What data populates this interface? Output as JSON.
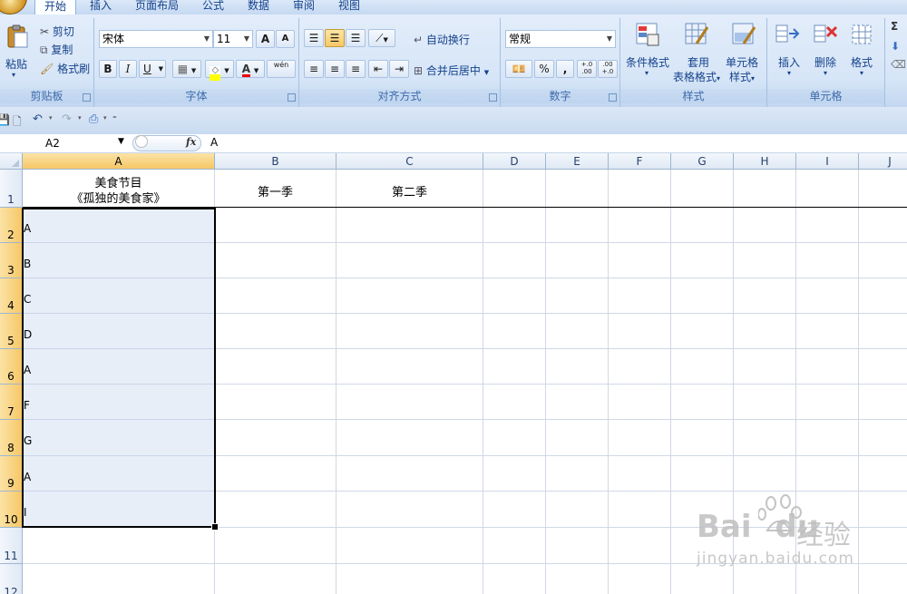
{
  "ribbon_tabs": [
    "开始",
    "插入",
    "页面布局",
    "公式",
    "数据",
    "审阅",
    "视图"
  ],
  "clipboard": {
    "paste": "粘贴",
    "cut": "剪切",
    "copy": "复制",
    "format_painter": "格式刷",
    "group": "剪贴板"
  },
  "font": {
    "name": "宋体",
    "size": "11",
    "group": "字体",
    "bold": "B",
    "italic": "I",
    "underline": "U",
    "font_color_label": "A",
    "phonetic": "wén",
    "grow": "A",
    "shrink": "A"
  },
  "alignment": {
    "wrap": "自动换行",
    "merge": "合并后居中",
    "group": "对齐方式"
  },
  "number": {
    "format": "常规",
    "percent": "%",
    "comma": ",",
    "inc_decimal": "+.0 .00",
    "dec_decimal": ".00 +.0",
    "group": "数字"
  },
  "styles": {
    "conditional": "条件格式",
    "table_line1": "套用",
    "table_line2": "表格格式",
    "cell_line1": "单元格",
    "cell_line2": "样式",
    "group": "样式"
  },
  "cells": {
    "insert": "插入",
    "delete": "删除",
    "format": "格式",
    "group": "单元格"
  },
  "editing": {
    "sum": "Σ"
  },
  "formula_bar": {
    "name_box": "A2",
    "fx": "fx",
    "content": "A"
  },
  "columns": [
    "A",
    "B",
    "C",
    "D",
    "E",
    "F",
    "G",
    "H",
    "I",
    "J"
  ],
  "rows": [
    "1",
    "2",
    "3",
    "4",
    "5",
    "6",
    "7",
    "8",
    "9",
    "10",
    "11",
    "12"
  ],
  "sheet": {
    "A1_line1": "美食节目",
    "A1_line2": "《孤独的美食家》",
    "B1": "第一季",
    "C1": "第二季",
    "column_a_values": [
      "A",
      "B",
      "C",
      "D",
      "A",
      "F",
      "G",
      "A",
      "I"
    ]
  },
  "watermark": {
    "brand": "Bai",
    "brand2": "du",
    "cn": "经验",
    "url": "jingyan.baidu.com"
  },
  "colors": {
    "selected_header": "#f6c766",
    "selection_fill": "#dde4f3",
    "ribbon_bg": "#d6e5f7",
    "gridline": "#d0d7e5"
  }
}
